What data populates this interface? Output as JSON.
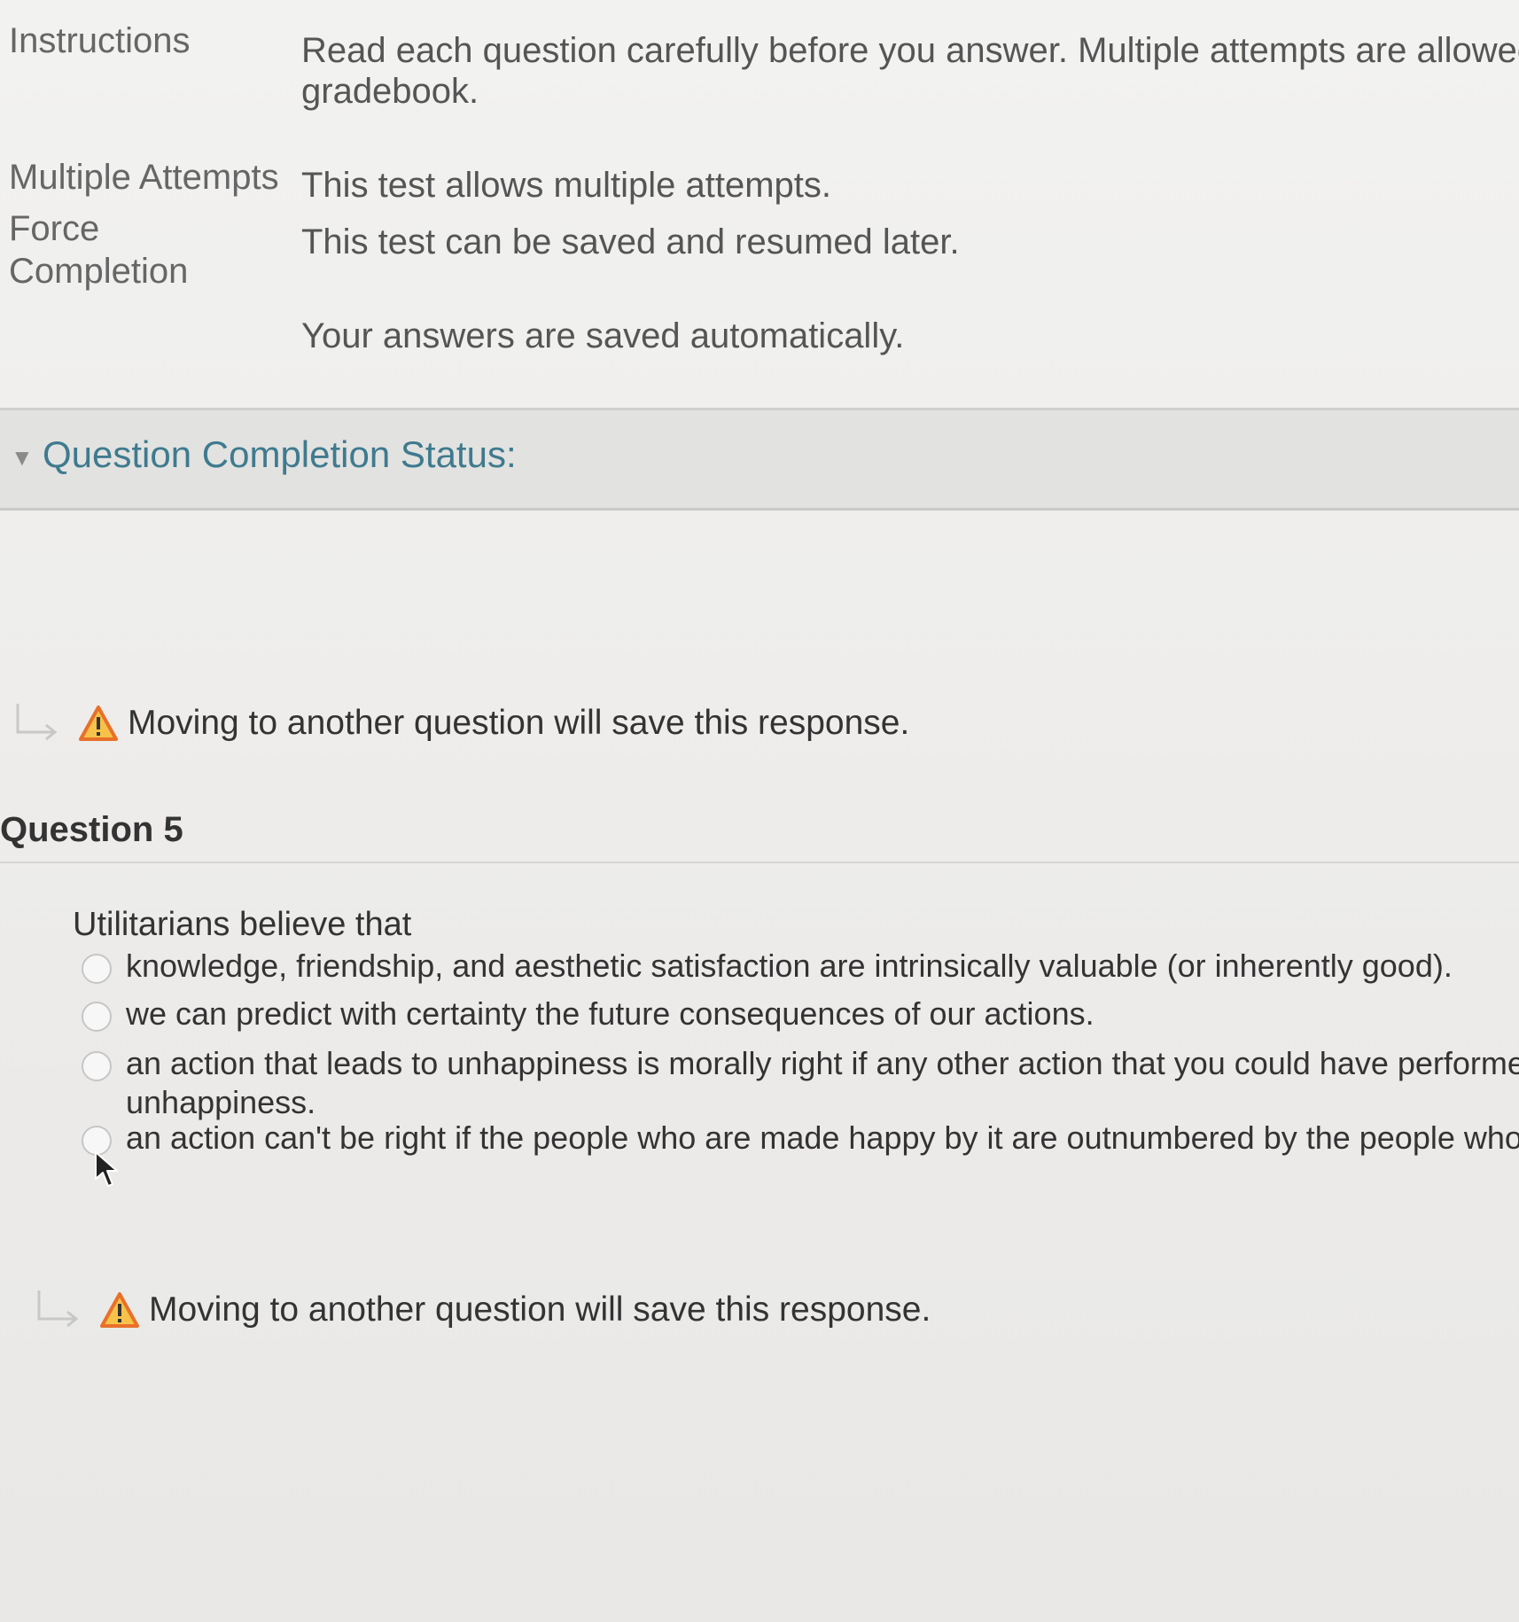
{
  "info": {
    "instructions": {
      "label": "Instructions",
      "value_line1": "Read each question carefully before you answer. Multiple attempts are allowed on",
      "value_line2": "gradebook."
    },
    "multiple_attempts": {
      "label": "Multiple Attempts",
      "value": "This test allows multiple attempts."
    },
    "force_completion": {
      "label_line1": "Force",
      "label_line2": "Completion",
      "value": "This test can be saved and resumed later."
    },
    "autosave": {
      "value": "Your answers are saved automatically."
    }
  },
  "status": {
    "label": "Question Completion Status:",
    "chevron": "chevron-down-icon"
  },
  "notice": {
    "text": "Moving to another question will save this response.",
    "icon": "warning-icon",
    "arrow_icon": "return-arrow-icon",
    "warn_color": "#e8702a"
  },
  "question": {
    "title": "Question 5",
    "prompt": "Utilitarians believe that",
    "options": [
      {
        "text": "knowledge, friendship, and aesthetic satisfaction are intrinsically valuable (or inherently good)."
      },
      {
        "text": "we can predict with certainty the future consequences of our actions."
      },
      {
        "text_line1": "an action that leads to unhappiness is morally right if any other action that you could have performed",
        "text_line2": "unhappiness."
      },
      {
        "text": "an action can't be right if the people who are made happy by it are outnumbered by the people who a"
      }
    ]
  },
  "colors": {
    "status_link": "#3f7a8f",
    "status_bar_bg": "#e2e2e0",
    "page_bg": "#efefed"
  }
}
